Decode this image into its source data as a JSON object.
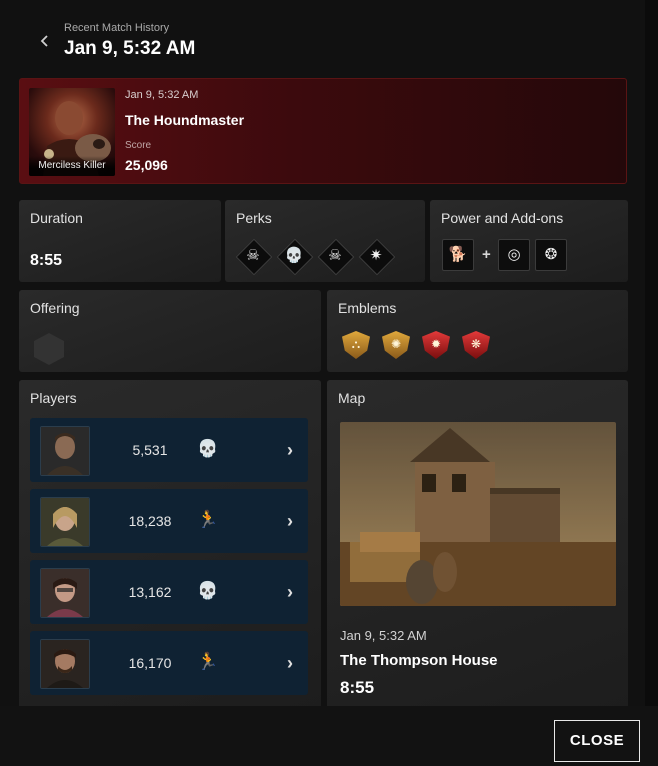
{
  "header": {
    "subtitle": "Recent Match History",
    "title": "Jan 9, 5:32 AM",
    "back_icon": "chevron-left-icon"
  },
  "banner": {
    "caption": "Merciless Killer",
    "date": "Jan 9, 5:32 AM",
    "character": "The Houndmaster",
    "score_label": "Score",
    "score": "25,096"
  },
  "duration": {
    "title": "Duration",
    "value": "8:55"
  },
  "perks": {
    "title": "Perks",
    "items": [
      {
        "icon": "skull-crossbones-icon",
        "glyph": "☠"
      },
      {
        "icon": "skull-mask-icon",
        "glyph": "💀"
      },
      {
        "icon": "hooded-skull-icon",
        "glyph": "☠"
      },
      {
        "icon": "beast-head-icon",
        "glyph": "✷"
      }
    ]
  },
  "power": {
    "title": "Power and Add-ons",
    "plus": "+",
    "items": [
      {
        "icon": "hound-power-icon",
        "glyph": "🐕"
      },
      {
        "icon": "collar-addon-icon",
        "glyph": "◎"
      },
      {
        "icon": "paw-addon-icon",
        "glyph": "❂"
      }
    ]
  },
  "offering": {
    "title": "Offering"
  },
  "emblems": {
    "title": "Emblems",
    "items": [
      {
        "icon": "gatekeeper-emblem-icon",
        "color": "#c9892a"
      },
      {
        "icon": "devout-emblem-icon",
        "color": "#c9892a"
      },
      {
        "icon": "malicious-emblem-icon",
        "color": "#b81d1d"
      },
      {
        "icon": "chaser-emblem-icon",
        "color": "#b81d1d"
      }
    ]
  },
  "players": {
    "title": "Players",
    "rows": [
      {
        "score": "5,531",
        "status_icon": "sacrificed-skull-icon",
        "status_glyph": "💀"
      },
      {
        "score": "18,238",
        "status_icon": "escaped-exit-icon",
        "status_glyph": "🏃"
      },
      {
        "score": "13,162",
        "status_icon": "sacrificed-skull-icon",
        "status_glyph": "💀"
      },
      {
        "score": "16,170",
        "status_icon": "escaped-exit-icon",
        "status_glyph": "🏃"
      }
    ]
  },
  "map": {
    "title": "Map",
    "date": "Jan 9, 5:32 AM",
    "name": "The Thompson House",
    "duration": "8:55"
  },
  "footer": {
    "close_label": "CLOSE"
  }
}
